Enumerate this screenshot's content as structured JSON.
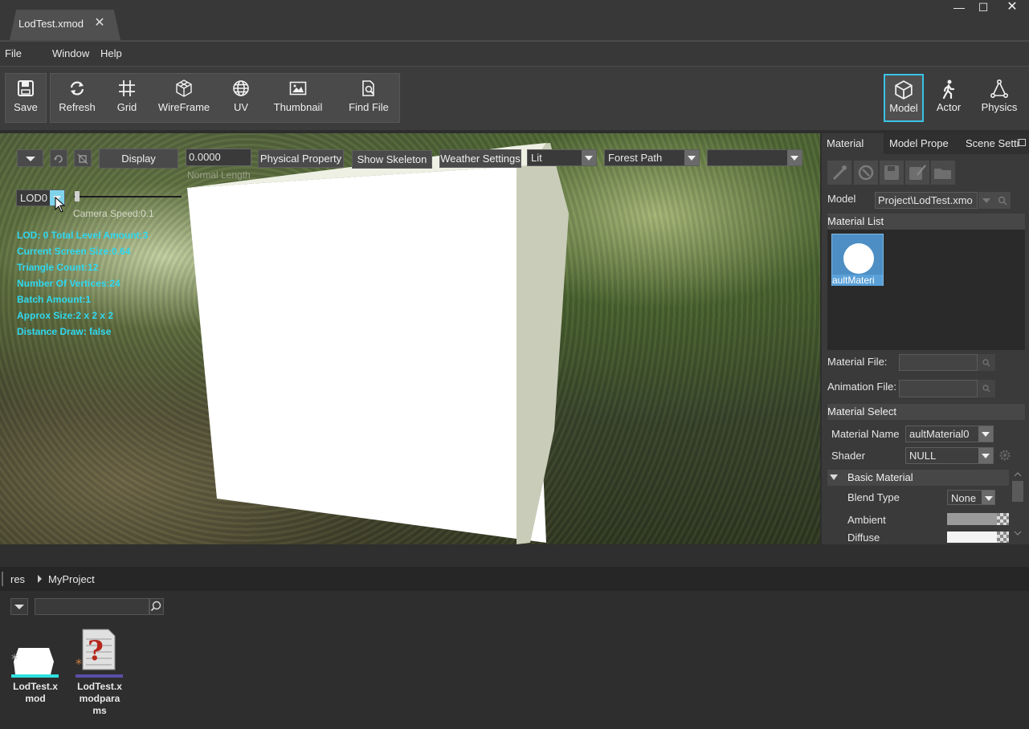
{
  "tab": {
    "title": "LodTest.xmod",
    "close": "✕"
  },
  "window_controls": {
    "minimize": "—",
    "maximize": "☐",
    "close": "✕"
  },
  "menu": {
    "file": "File",
    "window": "Window",
    "help": "Help"
  },
  "toolbar": {
    "save": "Save",
    "refresh": "Refresh",
    "grid": "Grid",
    "wireframe": "WireFrame",
    "uv": "UV",
    "thumbnail": "Thumbnail",
    "find_file": "Find File",
    "model": "Model",
    "actor": "Actor",
    "physics": "Physics"
  },
  "viewport": {
    "display": "Display",
    "normal_value": "0.0000",
    "normal_label": "Normal Length",
    "physical_property": "Physical Property",
    "show_skeleton": "Show Skeleton",
    "weather_settings": "Weather Settings",
    "lit": "Lit",
    "forest_path": "Forest Path",
    "empty_combo": "",
    "lod": "LOD0",
    "camera_speed": "Camera Speed:0.1",
    "stats": [
      "LOD: 0 Total Level Amount:3",
      "Current Screen Size:0.64",
      "Triangle Count:12",
      "Number Of Vertices:24",
      "Batch Amount:1",
      "Approx Size:2 x 2 x 2",
      "Distance Draw: false"
    ]
  },
  "right_panel": {
    "tabs": [
      "Material",
      "Model Prope",
      "Scene Setti"
    ],
    "model_label": "Model",
    "model_value": "Project\\LodTest.xmo",
    "material_list": "Material List",
    "material_thumb_label": "aultMateri",
    "material_file": "Material File:",
    "animation_file": "Animation File:",
    "material_select": "Material Select",
    "material_name_label": "Material Name",
    "material_name_value": "aultMaterial0",
    "shader_label": "Shader",
    "shader_value": "NULL",
    "basic_material": "Basic Material",
    "blend_type_label": "Blend Type",
    "blend_type_value": "None",
    "ambient_label": "Ambient",
    "diffuse_label": "Diffuse"
  },
  "browser": {
    "breadcrumb_root": "res",
    "breadcrumb_child": "MyProject",
    "search_placeholder": "",
    "files": [
      {
        "name": "LodTest.x\nmod",
        "accent": "#2fe0e0"
      },
      {
        "name": "LodTest.x\nmodpara\nms",
        "accent": "#5a4fa8"
      }
    ]
  }
}
